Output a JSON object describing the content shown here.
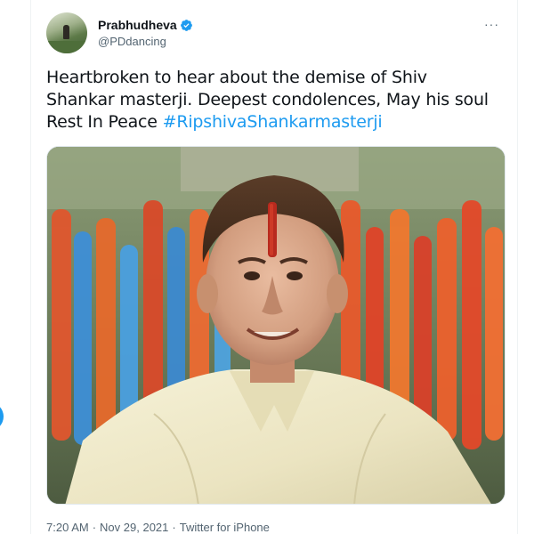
{
  "tweet": {
    "author": {
      "display_name": "Prabhudheva",
      "handle": "@PDdancing",
      "verified": true
    },
    "text_main": "Heartbroken to hear about the demise of Shiv Shankar masterji. Deepest condolences, May his soul Rest In Peace",
    "hashtag": "#RipshivaShankarmasterji",
    "timestamp_time": "7:20 AM",
    "timestamp_date": "Nov 29, 2021",
    "source": "Twitter for iPhone",
    "separator": "·",
    "more_glyph": "···"
  },
  "colors": {
    "accent": "#1d9bf0",
    "text": "#0f1419",
    "secondary_text": "#536471"
  },
  "icons": {
    "verified": "verified-badge-icon",
    "more": "more-options-icon"
  }
}
